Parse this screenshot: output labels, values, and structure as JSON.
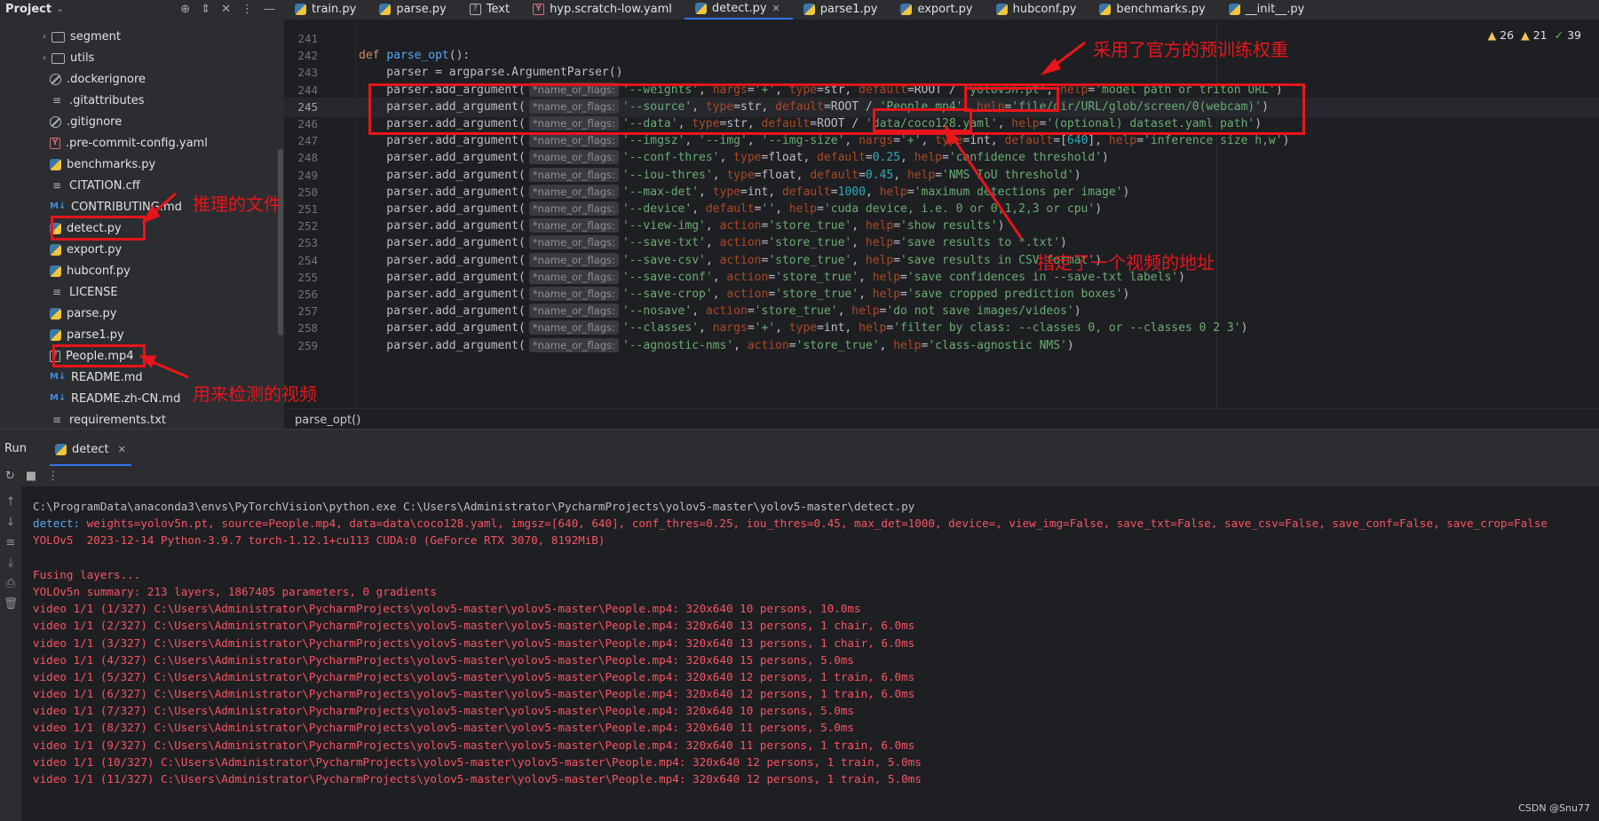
{
  "project": {
    "title": "Project",
    "tree": [
      {
        "label": "segment",
        "type": "folder",
        "expandable": true
      },
      {
        "label": "utils",
        "type": "folder",
        "expandable": true
      },
      {
        "label": ".dockerignore",
        "type": "ignore"
      },
      {
        "label": ".gitattributes",
        "type": "text"
      },
      {
        "label": ".gitignore",
        "type": "ignore"
      },
      {
        "label": ".pre-commit-config.yaml",
        "type": "yaml"
      },
      {
        "label": "benchmarks.py",
        "type": "py"
      },
      {
        "label": "CITATION.cff",
        "type": "text"
      },
      {
        "label": "CONTRIBUTING.md",
        "type": "md"
      },
      {
        "label": "detect.py",
        "type": "py"
      },
      {
        "label": "export.py",
        "type": "py"
      },
      {
        "label": "hubconf.py",
        "type": "py"
      },
      {
        "label": "LICENSE",
        "type": "text"
      },
      {
        "label": "parse.py",
        "type": "py"
      },
      {
        "label": "parse1.py",
        "type": "py"
      },
      {
        "label": "People.mp4",
        "type": "unknown"
      },
      {
        "label": "README.md",
        "type": "md"
      },
      {
        "label": "README.zh-CN.md",
        "type": "md"
      },
      {
        "label": "requirements.txt",
        "type": "text"
      }
    ]
  },
  "tabs": [
    {
      "label": "train.py",
      "icon": "py"
    },
    {
      "label": "parse.py",
      "icon": "py"
    },
    {
      "label": "Text",
      "icon": "unknown"
    },
    {
      "label": "hyp.scratch-low.yaml",
      "icon": "yaml"
    },
    {
      "label": "detect.py",
      "icon": "py",
      "active": true
    },
    {
      "label": "parse1.py",
      "icon": "py"
    },
    {
      "label": "export.py",
      "icon": "py"
    },
    {
      "label": "hubconf.py",
      "icon": "py"
    },
    {
      "label": "benchmarks.py",
      "icon": "py"
    },
    {
      "label": "__init__.py",
      "icon": "py"
    }
  ],
  "inspections": {
    "warnings_a": "26",
    "warnings_b": "21",
    "ok": "39"
  },
  "editor": {
    "hint": "*name_or_flags:",
    "lines": [
      {
        "n": "241",
        "html": ""
      },
      {
        "n": "242",
        "html": "<span class='kw'>def</span> <span class='fn'>parse_opt</span>():"
      },
      {
        "n": "243",
        "html": "    parser = argparse.ArgumentParser()"
      },
      {
        "n": "244",
        "html": "    parser.add_argument(<span class='hint'>*name_or_flags:</span><span class='str'>'--weights'</span>, <span class='kwarg'>nargs</span>=<span class='str'>'+'</span>, <span class='kwarg'>type</span>=str, <span class='kwarg'>default</span>=ROOT / <span class='str'>'yolov5n.pt'</span>, <span class='kwarg'>help</span>=<span class='str'>'model path or triton URL'</span>)"
      },
      {
        "n": "245",
        "html": "    parser.add_argument(<span class='hint'>*name_or_flags:</span><span class='str'>'--source'</span>, <span class='kwarg'>type</span>=str, <span class='kwarg'>default</span>=ROOT / <span class='str'>'People.mp4'</span>, <span class='kwarg'>help</span>=<span class='str'>'file/dir/URL/glob/screen/0(webcam)'</span>)",
        "current": true
      },
      {
        "n": "246",
        "html": "    parser.add_argument(<span class='hint'>*name_or_flags:</span><span class='str'>'--data'</span>, <span class='kwarg'>type</span>=str, <span class='kwarg'>default</span>=ROOT / <span class='str'>'data/coco128.yaml'</span>, <span class='kwarg'>help</span>=<span class='str'>'(optional) dataset.yaml path'</span>)"
      },
      {
        "n": "247",
        "html": "    parser.add_argument(<span class='hint'>*name_or_flags:</span><span class='str'>'--imgsz'</span>, <span class='str'>'--img'</span>, <span class='str'>'--img-size'</span>, <span class='kwarg'>nargs</span>=<span class='str'>'+'</span>, <span class='kwarg'>type</span>=int, <span class='kwarg'>default</span>=[<span class='num'>640</span>], <span class='kwarg'>help</span>=<span class='str'>'inference size h,w'</span>)"
      },
      {
        "n": "248",
        "html": "    parser.add_argument(<span class='hint'>*name_or_flags:</span><span class='str'>'--conf-thres'</span>, <span class='kwarg'>type</span>=float, <span class='kwarg'>default</span>=<span class='num'>0.25</span>, <span class='kwarg'>help</span>=<span class='str'>'confidence threshold'</span>)"
      },
      {
        "n": "249",
        "html": "    parser.add_argument(<span class='hint'>*name_or_flags:</span><span class='str'>'--iou-thres'</span>, <span class='kwarg'>type</span>=float, <span class='kwarg'>default</span>=<span class='num'>0.45</span>, <span class='kwarg'>help</span>=<span class='str'>'NMS IoU threshold'</span>)"
      },
      {
        "n": "250",
        "html": "    parser.add_argument(<span class='hint'>*name_or_flags:</span><span class='str'>'--max-det'</span>, <span class='kwarg'>type</span>=int, <span class='kwarg'>default</span>=<span class='num'>1000</span>, <span class='kwarg'>help</span>=<span class='str'>'maximum detections per image'</span>)"
      },
      {
        "n": "251",
        "html": "    parser.add_argument(<span class='hint'>*name_or_flags:</span><span class='str'>'--device'</span>, <span class='kwarg'>default</span>=<span class='str'>''</span>, <span class='kwarg'>help</span>=<span class='str'>'cuda device, i.e. 0 or 0,1,2,3 or cpu'</span>)"
      },
      {
        "n": "252",
        "html": "    parser.add_argument(<span class='hint'>*name_or_flags:</span><span class='str'>'--view-img'</span>, <span class='kwarg'>action</span>=<span class='str'>'store_true'</span>, <span class='kwarg'>help</span>=<span class='str'>'show results'</span>)"
      },
      {
        "n": "253",
        "html": "    parser.add_argument(<span class='hint'>*name_or_flags:</span><span class='str'>'--save-txt'</span>, <span class='kwarg'>action</span>=<span class='str'>'store_true'</span>, <span class='kwarg'>help</span>=<span class='str'>'save results to *.txt'</span>)"
      },
      {
        "n": "254",
        "html": "    parser.add_argument(<span class='hint'>*name_or_flags:</span><span class='str'>'--save-csv'</span>, <span class='kwarg'>action</span>=<span class='str'>'store_true'</span>, <span class='kwarg'>help</span>=<span class='str'>'save results in CSV format'</span>)"
      },
      {
        "n": "255",
        "html": "    parser.add_argument(<span class='hint'>*name_or_flags:</span><span class='str'>'--save-conf'</span>, <span class='kwarg'>action</span>=<span class='str'>'store_true'</span>, <span class='kwarg'>help</span>=<span class='str'>'save confidences in --save-txt labels'</span>)"
      },
      {
        "n": "256",
        "html": "    parser.add_argument(<span class='hint'>*name_or_flags:</span><span class='str'>'--save-crop'</span>, <span class='kwarg'>action</span>=<span class='str'>'store_true'</span>, <span class='kwarg'>help</span>=<span class='str'>'save cropped prediction boxes'</span>)"
      },
      {
        "n": "257",
        "html": "    parser.add_argument(<span class='hint'>*name_or_flags:</span><span class='str'>'--nosave'</span>, <span class='kwarg'>action</span>=<span class='str'>'store_true'</span>, <span class='kwarg'>help</span>=<span class='str'>'do not save images/videos'</span>)"
      },
      {
        "n": "258",
        "html": "    parser.add_argument(<span class='hint'>*name_or_flags:</span><span class='str'>'--classes'</span>, <span class='kwarg'>nargs</span>=<span class='str'>'+'</span>, <span class='kwarg'>type</span>=int, <span class='kwarg'>help</span>=<span class='str'>'filter by class: --classes 0, or --classes 0 2 3'</span>)"
      },
      {
        "n": "259",
        "html": "    parser.add_argument(<span class='hint'>*name_or_flags:</span><span class='str'>'--agnostic-nms'</span>, <span class='kwarg'>action</span>=<span class='str'>'store_true'</span>, <span class='kwarg'>help</span>=<span class='str'>'class-agnostic NMS'</span>)"
      }
    ]
  },
  "breadcrumb": "parse_opt()",
  "run": {
    "title": "Run",
    "tab_label": "detect",
    "output": [
      {
        "c": "white",
        "t": "C:\\ProgramData\\anaconda3\\envs\\PyTorchVision\\python.exe C:\\Users\\Administrator\\PycharmProjects\\yolov5-master\\yolov5-master\\detect.py"
      },
      {
        "c": "mixed",
        "p": "detect: ",
        "t": "weights=yolov5n.pt, source=People.mp4, data=data\\coco128.yaml, imgsz=[640, 640], conf_thres=0.25, iou_thres=0.45, max_det=1000, device=, view_img=False, save_txt=False, save_csv=False, save_conf=False, save_crop=False"
      },
      {
        "c": "red",
        "t": "YOLOv5  2023-12-14 Python-3.9.7 torch-1.12.1+cu113 CUDA:0 (GeForce RTX 3070, 8192MiB)"
      },
      {
        "c": "red",
        "t": ""
      },
      {
        "c": "red",
        "t": "Fusing layers... "
      },
      {
        "c": "red",
        "t": "YOLOv5n summary: 213 layers, 1867405 parameters, 0 gradients"
      },
      {
        "c": "red",
        "t": "video 1/1 (1/327) C:\\Users\\Administrator\\PycharmProjects\\yolov5-master\\yolov5-master\\People.mp4: 320x640 10 persons, 10.0ms"
      },
      {
        "c": "red",
        "t": "video 1/1 (2/327) C:\\Users\\Administrator\\PycharmProjects\\yolov5-master\\yolov5-master\\People.mp4: 320x640 13 persons, 1 chair, 6.0ms"
      },
      {
        "c": "red",
        "t": "video 1/1 (3/327) C:\\Users\\Administrator\\PycharmProjects\\yolov5-master\\yolov5-master\\People.mp4: 320x640 13 persons, 1 chair, 6.0ms"
      },
      {
        "c": "red",
        "t": "video 1/1 (4/327) C:\\Users\\Administrator\\PycharmProjects\\yolov5-master\\yolov5-master\\People.mp4: 320x640 15 persons, 5.0ms"
      },
      {
        "c": "red",
        "t": "video 1/1 (5/327) C:\\Users\\Administrator\\PycharmProjects\\yolov5-master\\yolov5-master\\People.mp4: 320x640 12 persons, 1 train, 6.0ms"
      },
      {
        "c": "red",
        "t": "video 1/1 (6/327) C:\\Users\\Administrator\\PycharmProjects\\yolov5-master\\yolov5-master\\People.mp4: 320x640 12 persons, 1 train, 6.0ms"
      },
      {
        "c": "red",
        "t": "video 1/1 (7/327) C:\\Users\\Administrator\\PycharmProjects\\yolov5-master\\yolov5-master\\People.mp4: 320x640 10 persons, 5.0ms"
      },
      {
        "c": "red",
        "t": "video 1/1 (8/327) C:\\Users\\Administrator\\PycharmProjects\\yolov5-master\\yolov5-master\\People.mp4: 320x640 11 persons, 5.0ms"
      },
      {
        "c": "red",
        "t": "video 1/1 (9/327) C:\\Users\\Administrator\\PycharmProjects\\yolov5-master\\yolov5-master\\People.mp4: 320x640 11 persons, 1 train, 6.0ms"
      },
      {
        "c": "red",
        "t": "video 1/1 (10/327) C:\\Users\\Administrator\\PycharmProjects\\yolov5-master\\yolov5-master\\People.mp4: 320x640 12 persons, 1 train, 5.0ms"
      },
      {
        "c": "red",
        "t": "video 1/1 (11/327) C:\\Users\\Administrator\\PycharmProjects\\yolov5-master\\yolov5-master\\People.mp4: 320x640 12 persons, 1 train, 5.0ms"
      }
    ]
  },
  "annotations": {
    "weights": "采用了官方的预训练权重",
    "infer_file": "推理的文件",
    "video_path": "指定了一个视频的地址",
    "detect_video": "用来检测的视频"
  },
  "watermark": "CSDN @Snu77",
  "colors": {
    "annotation": "#e8151b",
    "accent": "#3574f0"
  }
}
